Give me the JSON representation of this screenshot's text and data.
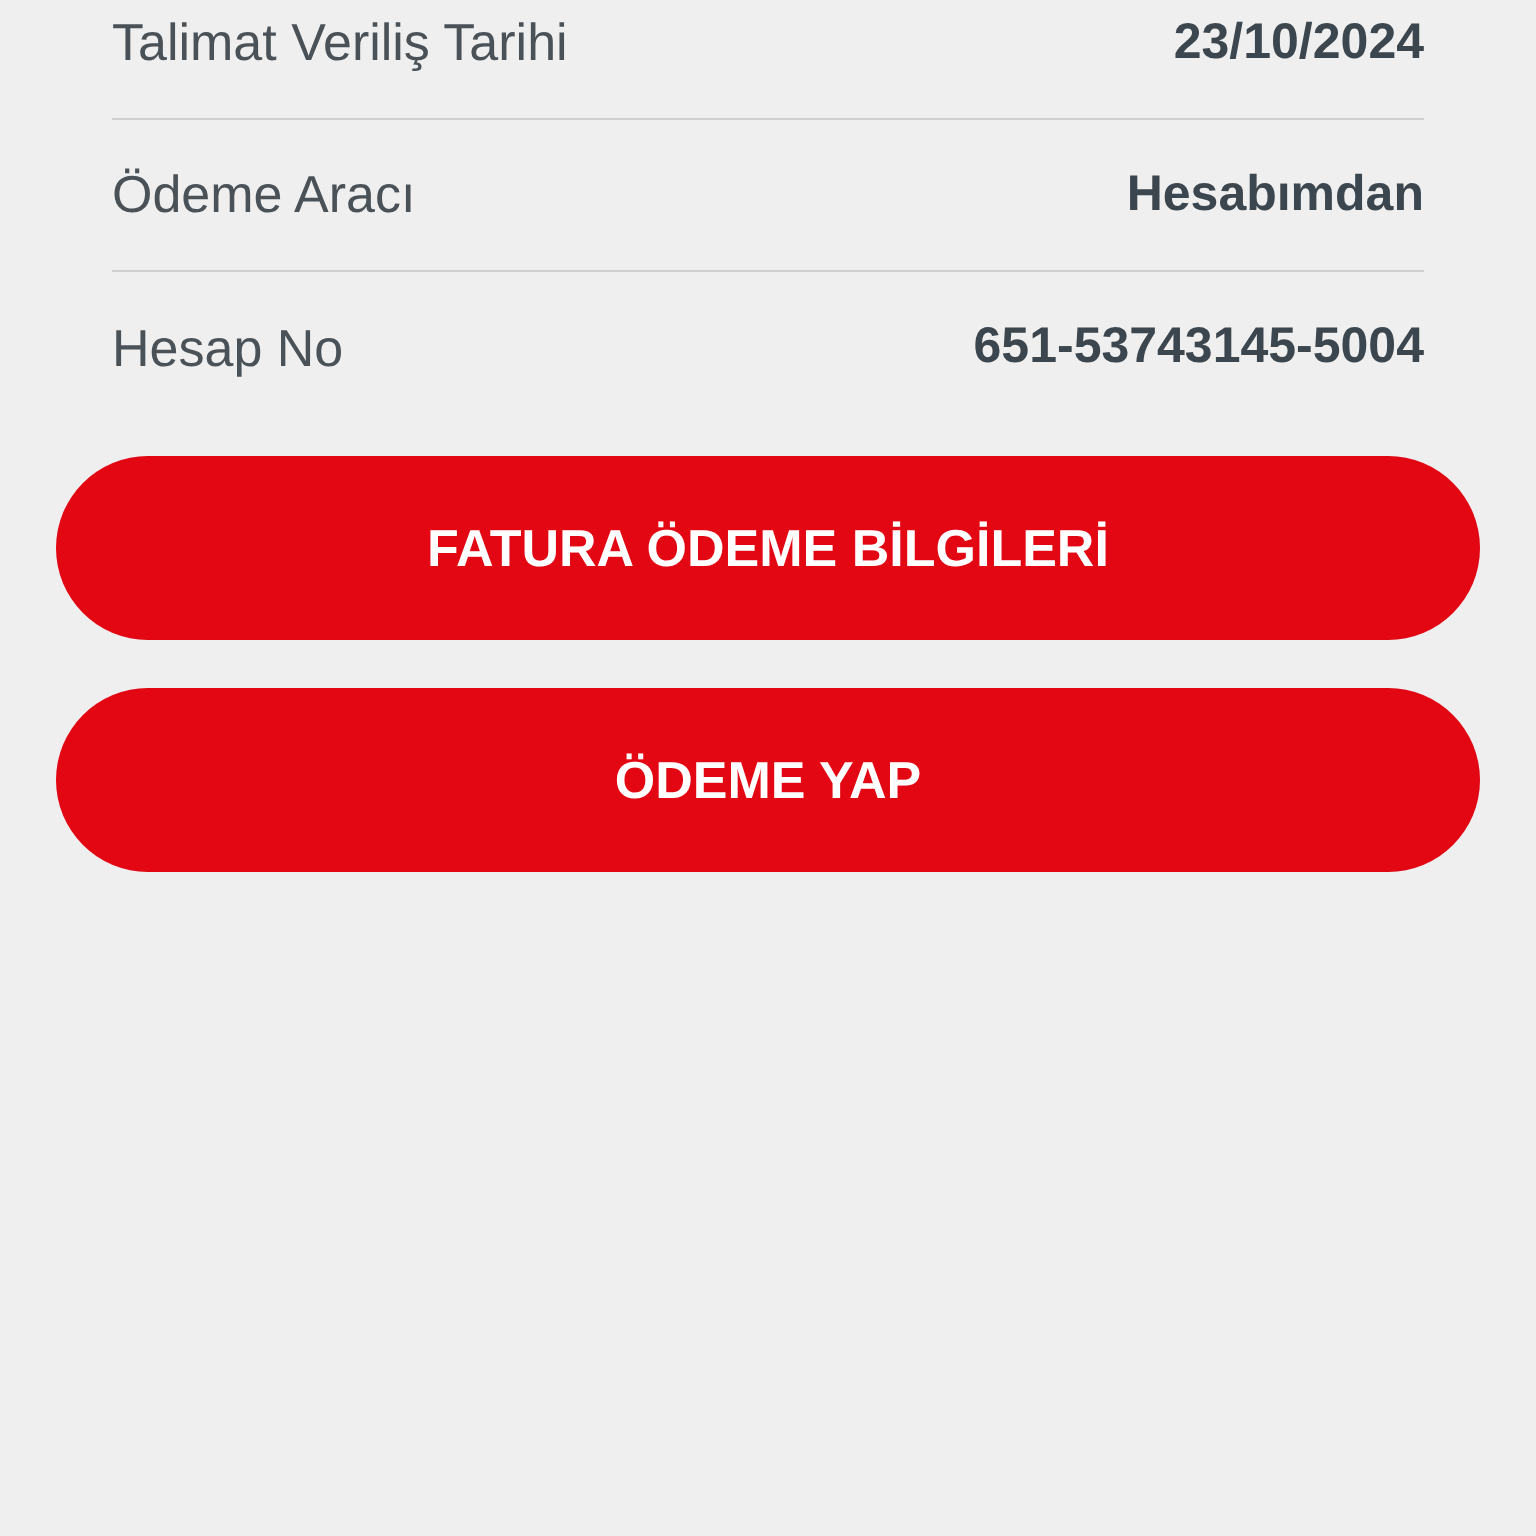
{
  "details": [
    {
      "label": "Talimat Veriliş Tarihi",
      "value": "23/10/2024"
    },
    {
      "label": "Ödeme Aracı",
      "value": "Hesabımdan"
    },
    {
      "label": "Hesap No",
      "value": "651-53743145-5004"
    }
  ],
  "buttons": [
    "FATURA ÖDEME BİLGİLERİ",
    "ÖDEME YAP"
  ]
}
